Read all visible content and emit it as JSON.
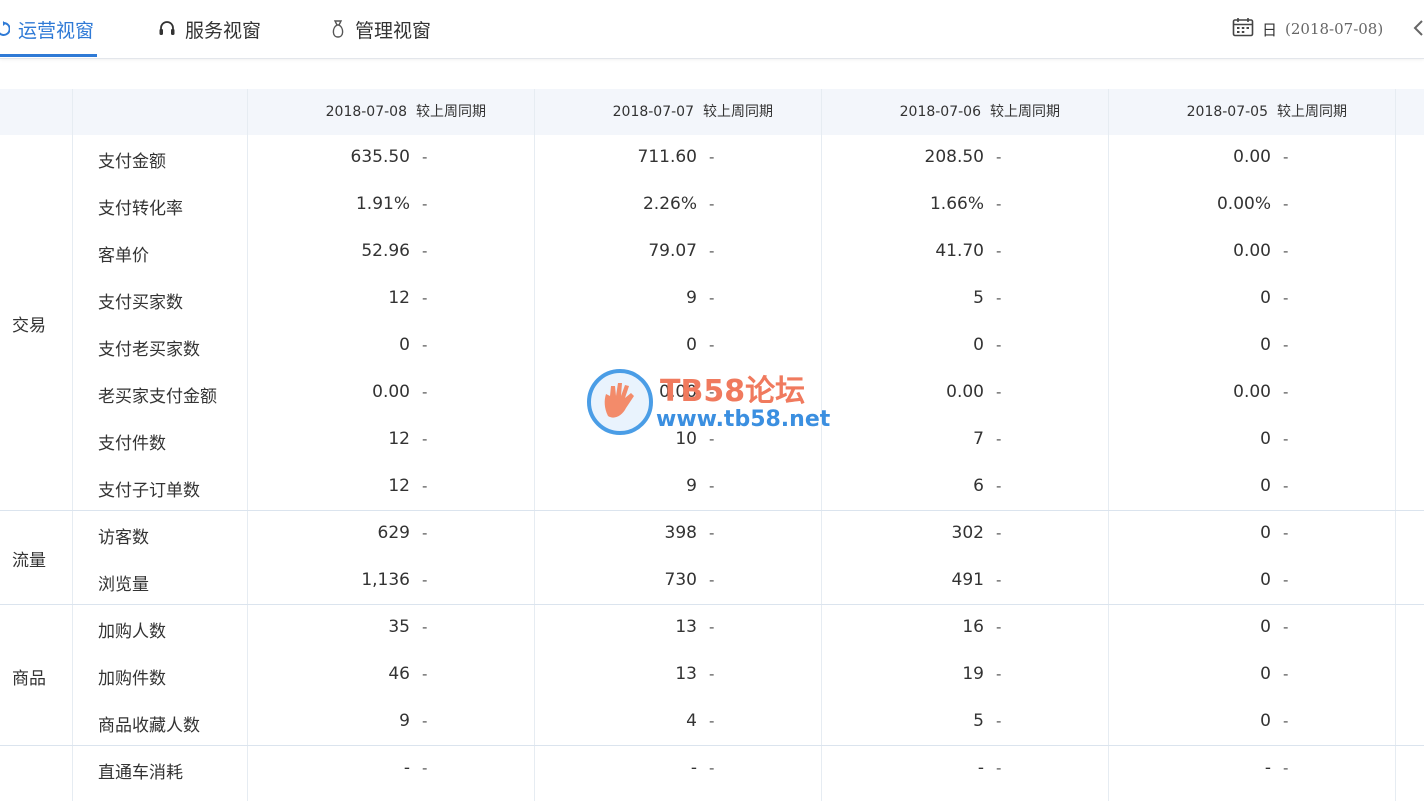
{
  "tabs": [
    {
      "label": "运营视窗",
      "icon": "refresh-icon",
      "active": true
    },
    {
      "label": "服务视窗",
      "icon": "headset-icon",
      "active": false
    },
    {
      "label": "管理视窗",
      "icon": "bag-icon",
      "active": false
    }
  ],
  "date_picker": {
    "icon": "calendar-icon",
    "period": "日",
    "value": "(2018-07-08)"
  },
  "colors": {
    "accent": "#2f7ad6",
    "header_bg": "#f3f6fb",
    "border": "#dbe4ee"
  },
  "table": {
    "compare_label": "较上周同期",
    "dates": [
      "2018-07-08",
      "2018-07-07",
      "2018-07-06",
      "2018-07-05"
    ],
    "groups": [
      {
        "category": "交易",
        "rows": [
          {
            "metric": "支付金额",
            "values": [
              "635.50",
              "711.60",
              "208.50",
              "0.00"
            ]
          },
          {
            "metric": "支付转化率",
            "values": [
              "1.91%",
              "2.26%",
              "1.66%",
              "0.00%"
            ]
          },
          {
            "metric": "客单价",
            "values": [
              "52.96",
              "79.07",
              "41.70",
              "0.00"
            ]
          },
          {
            "metric": "支付买家数",
            "values": [
              "12",
              "9",
              "5",
              "0"
            ]
          },
          {
            "metric": "支付老买家数",
            "values": [
              "0",
              "0",
              "0",
              "0"
            ]
          },
          {
            "metric": "老买家支付金额",
            "values": [
              "0.00",
              "0.00",
              "0.00",
              "0.00"
            ]
          },
          {
            "metric": "支付件数",
            "values": [
              "12",
              "10",
              "7",
              "0"
            ]
          },
          {
            "metric": "支付子订单数",
            "values": [
              "12",
              "9",
              "6",
              "0"
            ]
          }
        ]
      },
      {
        "category": "流量",
        "rows": [
          {
            "metric": "访客数",
            "values": [
              "629",
              "398",
              "302",
              "0"
            ]
          },
          {
            "metric": "浏览量",
            "values": [
              "1,136",
              "730",
              "491",
              "0"
            ]
          }
        ]
      },
      {
        "category": "商品",
        "rows": [
          {
            "metric": "加购人数",
            "values": [
              "35",
              "13",
              "16",
              "0"
            ]
          },
          {
            "metric": "加购件数",
            "values": [
              "46",
              "13",
              "19",
              "0"
            ]
          },
          {
            "metric": "商品收藏人数",
            "values": [
              "9",
              "4",
              "5",
              "0"
            ]
          }
        ]
      },
      {
        "category": "",
        "rows": [
          {
            "metric": "直通车消耗",
            "values": [
              "-",
              "-",
              "-",
              "-"
            ]
          }
        ]
      }
    ],
    "compare_value": "-"
  },
  "watermark": {
    "title": "TB58论坛",
    "url": "www.tb58.net"
  }
}
